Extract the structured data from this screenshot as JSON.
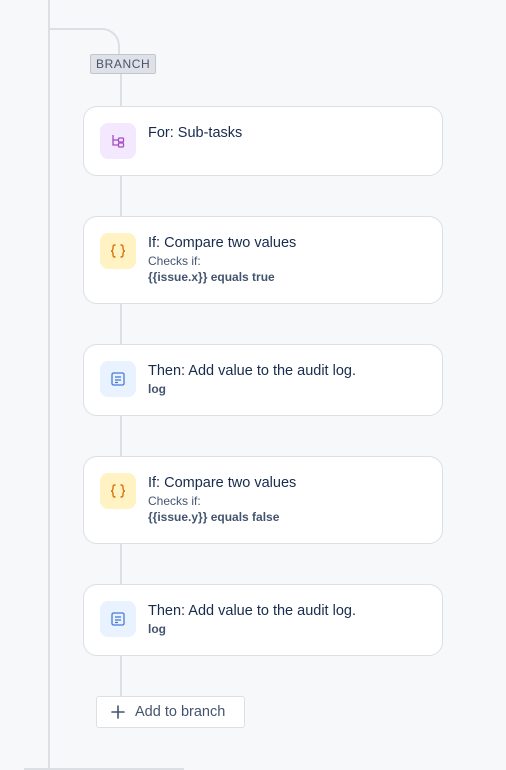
{
  "branch": {
    "badge": "BRANCH"
  },
  "cards": [
    {
      "kind": "for",
      "icon": "branch-icon",
      "title": "For: Sub-tasks"
    },
    {
      "kind": "condition",
      "icon": "braces-icon",
      "title": "If: Compare two values",
      "line1": "Checks if:",
      "line2": "{{issue.x}} equals true"
    },
    {
      "kind": "action",
      "icon": "audit-log-icon",
      "title": "Then: Add value to the audit log.",
      "line2": "log"
    },
    {
      "kind": "condition",
      "icon": "braces-icon",
      "title": "If: Compare two values",
      "line1": "Checks if:",
      "line2": "{{issue.y}} equals false"
    },
    {
      "kind": "action",
      "icon": "audit-log-icon",
      "title": "Then: Add value to the audit log.",
      "line2": "log"
    }
  ],
  "add_button": {
    "label": "Add to branch",
    "icon": "plus-icon"
  },
  "colors": {
    "purple_icon": "#a54cc9",
    "yellow_icon": "#d97008",
    "blue_icon": "#4c7ad8"
  }
}
